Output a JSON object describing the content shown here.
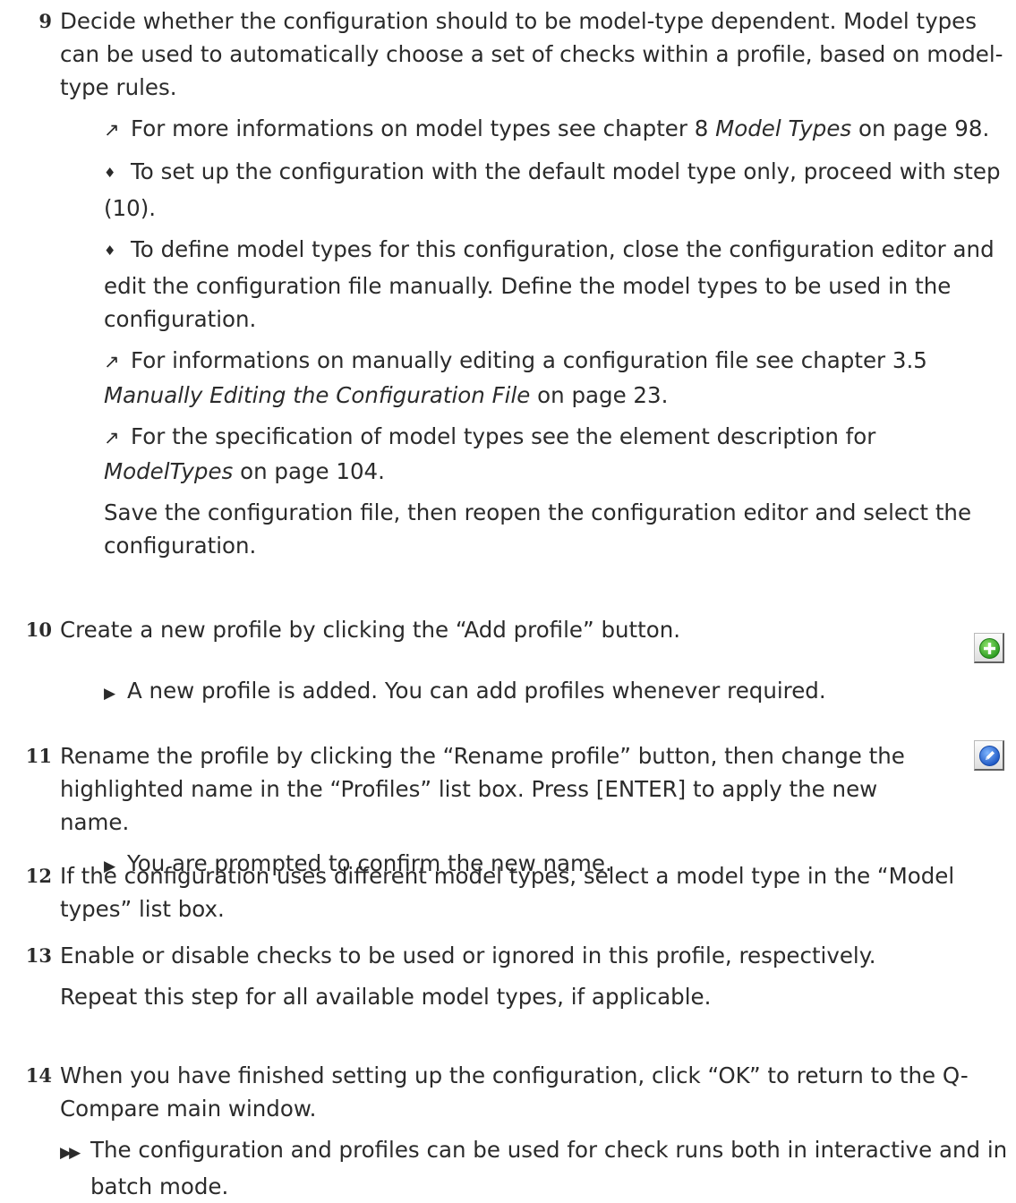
{
  "steps": [
    {
      "number": "9",
      "text": "Decide whether the configuration should to be model-type dependent. Model types can be used to automatically choose a set of checks within a profile, based on model-type rules.",
      "ref1": {
        "before": "For more informations on model types see chapter 8 ",
        "title": "Model Types",
        "after": " on page 98."
      },
      "option1": "To set up the configuration with the default model type only, proceed with step (10).",
      "option2": "To define model types for this configuration, close the configuration editor and edit the configuration file manually. Define the model types to be used in the configuration.",
      "ref2": {
        "before": "For informations on manually editing a configuration file see chapter 3.5 ",
        "title": "Manually Editing the Configuration File",
        "after": " on page 23."
      },
      "ref3": {
        "before": "For the specification of model types see the element description for ",
        "title": "ModelTypes",
        "after": " on page 104."
      },
      "note": "Save the configuration file, then reopen the configuration editor and select the configuration."
    },
    {
      "number": "10",
      "text": "Create a new profile by clicking the “Add profile” button.",
      "result": "A new profile is added. You can add profiles whenever required."
    },
    {
      "number": "11",
      "text": "Rename the profile by clicking the “Rename profile” button, then change the highlighted name in the “Profiles” list box. Press [ENTER] to apply the new name.",
      "result": "You are prompted to confirm the new name."
    },
    {
      "number": "12",
      "text": "If the configuration uses different model types, select a model type in the “Model types” list box."
    },
    {
      "number": "13",
      "text": "Enable or disable checks to be used or ignored in this profile, respectively.",
      "note": "Repeat this step for all available model types, if applicable."
    },
    {
      "number": "14",
      "text": "When you have finished setting up the configuration, click “OK” to return to the Q-Compare main window.",
      "final_result": "The configuration and profiles can be used for check runs both in interactive and in batch mode."
    }
  ],
  "markers": {
    "reference": "↗",
    "option": "♦",
    "result": "▶",
    "final_result": "▶▶"
  },
  "icons": {
    "add_profile": "add-profile-icon",
    "rename_profile": "rename-profile-icon"
  },
  "colors": {
    "text": "#2b2b2b",
    "add_green": "#3cb82e",
    "rename_blue": "#2f6fd6"
  }
}
